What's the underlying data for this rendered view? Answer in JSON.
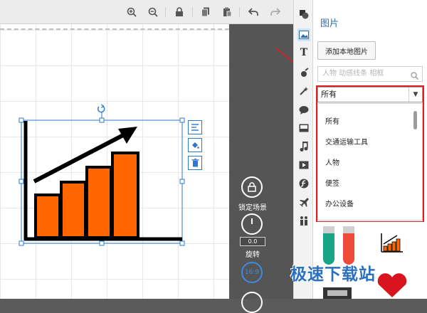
{
  "toolbar": {
    "buttons": [
      "zoom-in-icon",
      "zoom-out-icon",
      "lock-icon",
      "copy-icon",
      "paste-icon",
      "undo-icon",
      "redo-icon"
    ]
  },
  "scene_controls": {
    "lock_label": "锁定场景",
    "rotate_value": "0.0",
    "rotate_label": "旋转",
    "ratio_label": "16:9"
  },
  "panel": {
    "title": "图片",
    "add_local_image": "添加本地图片",
    "search_placeholder": "人物 动感线条 相框",
    "selected_category": "所有",
    "dropdown_options": [
      "所有",
      "交通运输工具",
      "人物",
      "便签",
      "办公设备"
    ]
  },
  "watermark": "极速下载站",
  "colors": {
    "accent_blue": "#2d6fb5",
    "highlight_red": "#e02020",
    "chart_bar_orange": "#ff6600",
    "selection_blue": "#2b78d0"
  }
}
